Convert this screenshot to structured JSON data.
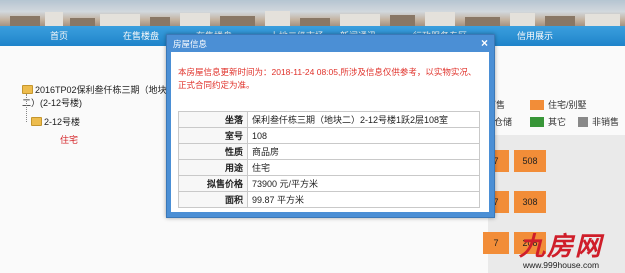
{
  "nav": {
    "items": [
      {
        "label": "首页"
      },
      {
        "label": "在售楼盘"
      },
      {
        "label": "在售楼盘"
      },
      {
        "label": "上地二级市场"
      },
      {
        "label": "新闻通讯"
      },
      {
        "label": "行政服务专区"
      },
      {
        "label": "信用展示"
      }
    ]
  },
  "tree": {
    "project": "2016TP02保利叁仟栋三期（地块二）(2-12号楼)",
    "building": "2-12号楼",
    "usage": "住宅"
  },
  "legend": {
    "items": [
      {
        "label": "不可售",
        "color": "#ffffff"
      },
      {
        "label": "住宅/别墅",
        "color": "#f7903a"
      },
      {
        "label": "仓储",
        "color": "#ffffff"
      },
      {
        "label": "其它",
        "color": "#3a9a3a"
      },
      {
        "label": "非销售",
        "color": "#8c8c8c"
      }
    ]
  },
  "grid": {
    "cells": [
      "7",
      "508",
      "7",
      "308",
      "7",
      "208"
    ]
  },
  "dialog": {
    "title": "房屋信息",
    "close": "×",
    "notice": "本房屋信息更新时间为：2018-11-24 08:05,所涉及信息仅供参考，以实物实况、正式合同约定为准。",
    "rows": [
      {
        "key": "坐落",
        "value": "保利叁仟栋三期（地块二）2-12号楼1跃2层108室"
      },
      {
        "key": "室号",
        "value": "108"
      },
      {
        "key": "性质",
        "value": "商品房"
      },
      {
        "key": "用途",
        "value": "住宅"
      },
      {
        "key": "拟售价格",
        "value": "73900 元/平方米"
      },
      {
        "key": "面积",
        "value": "99.87 平方米"
      }
    ]
  },
  "watermark": {
    "brand": "九房网",
    "url": "www.999house.com"
  }
}
